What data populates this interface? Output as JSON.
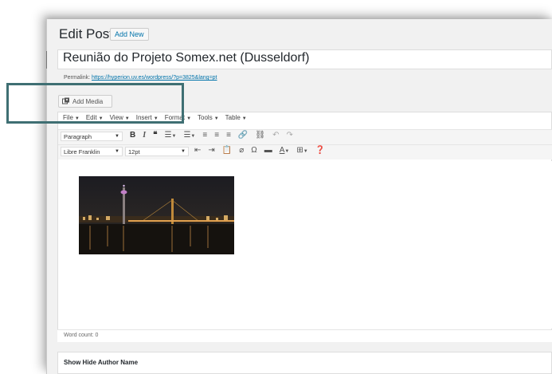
{
  "header": {
    "title": "Edit Post",
    "add_new_label": "Add New"
  },
  "post": {
    "title_value": "Reunião do Projeto Somex.net (Dusseldorf)",
    "permalink_label": "Permalink:",
    "permalink_url": "https://hyperion.uv.es/wordpress/?p=3825&lang=pt"
  },
  "media": {
    "add_media_label": "Add Media"
  },
  "menubar": {
    "items": [
      "File",
      "Edit",
      "View",
      "Insert",
      "Format",
      "Tools",
      "Table"
    ]
  },
  "toolbar": {
    "block_format": "Paragraph",
    "font_family": "Libre Franklin",
    "font_size": "12pt",
    "icons": {
      "row1": [
        "bold-icon",
        "italic-icon",
        "blockquote-icon",
        "bullet-list-icon",
        "numbered-list-icon",
        "align-left-icon",
        "align-center-icon",
        "align-right-icon",
        "link-icon",
        "unlink-icon",
        "undo-icon",
        "redo-icon"
      ],
      "row2": [
        "outdent-icon",
        "indent-icon",
        "paste-text-icon",
        "clear-formatting-icon",
        "special-character-icon",
        "horizontal-line-icon",
        "text-color-icon",
        "table-icon",
        "help-icon"
      ]
    }
  },
  "footer": {
    "word_count": "Word count: 0"
  },
  "author_box": {
    "label": "Show Hide Author Name"
  },
  "colors": {
    "highlight_border": "#3f6f73",
    "link": "#0073aa"
  }
}
